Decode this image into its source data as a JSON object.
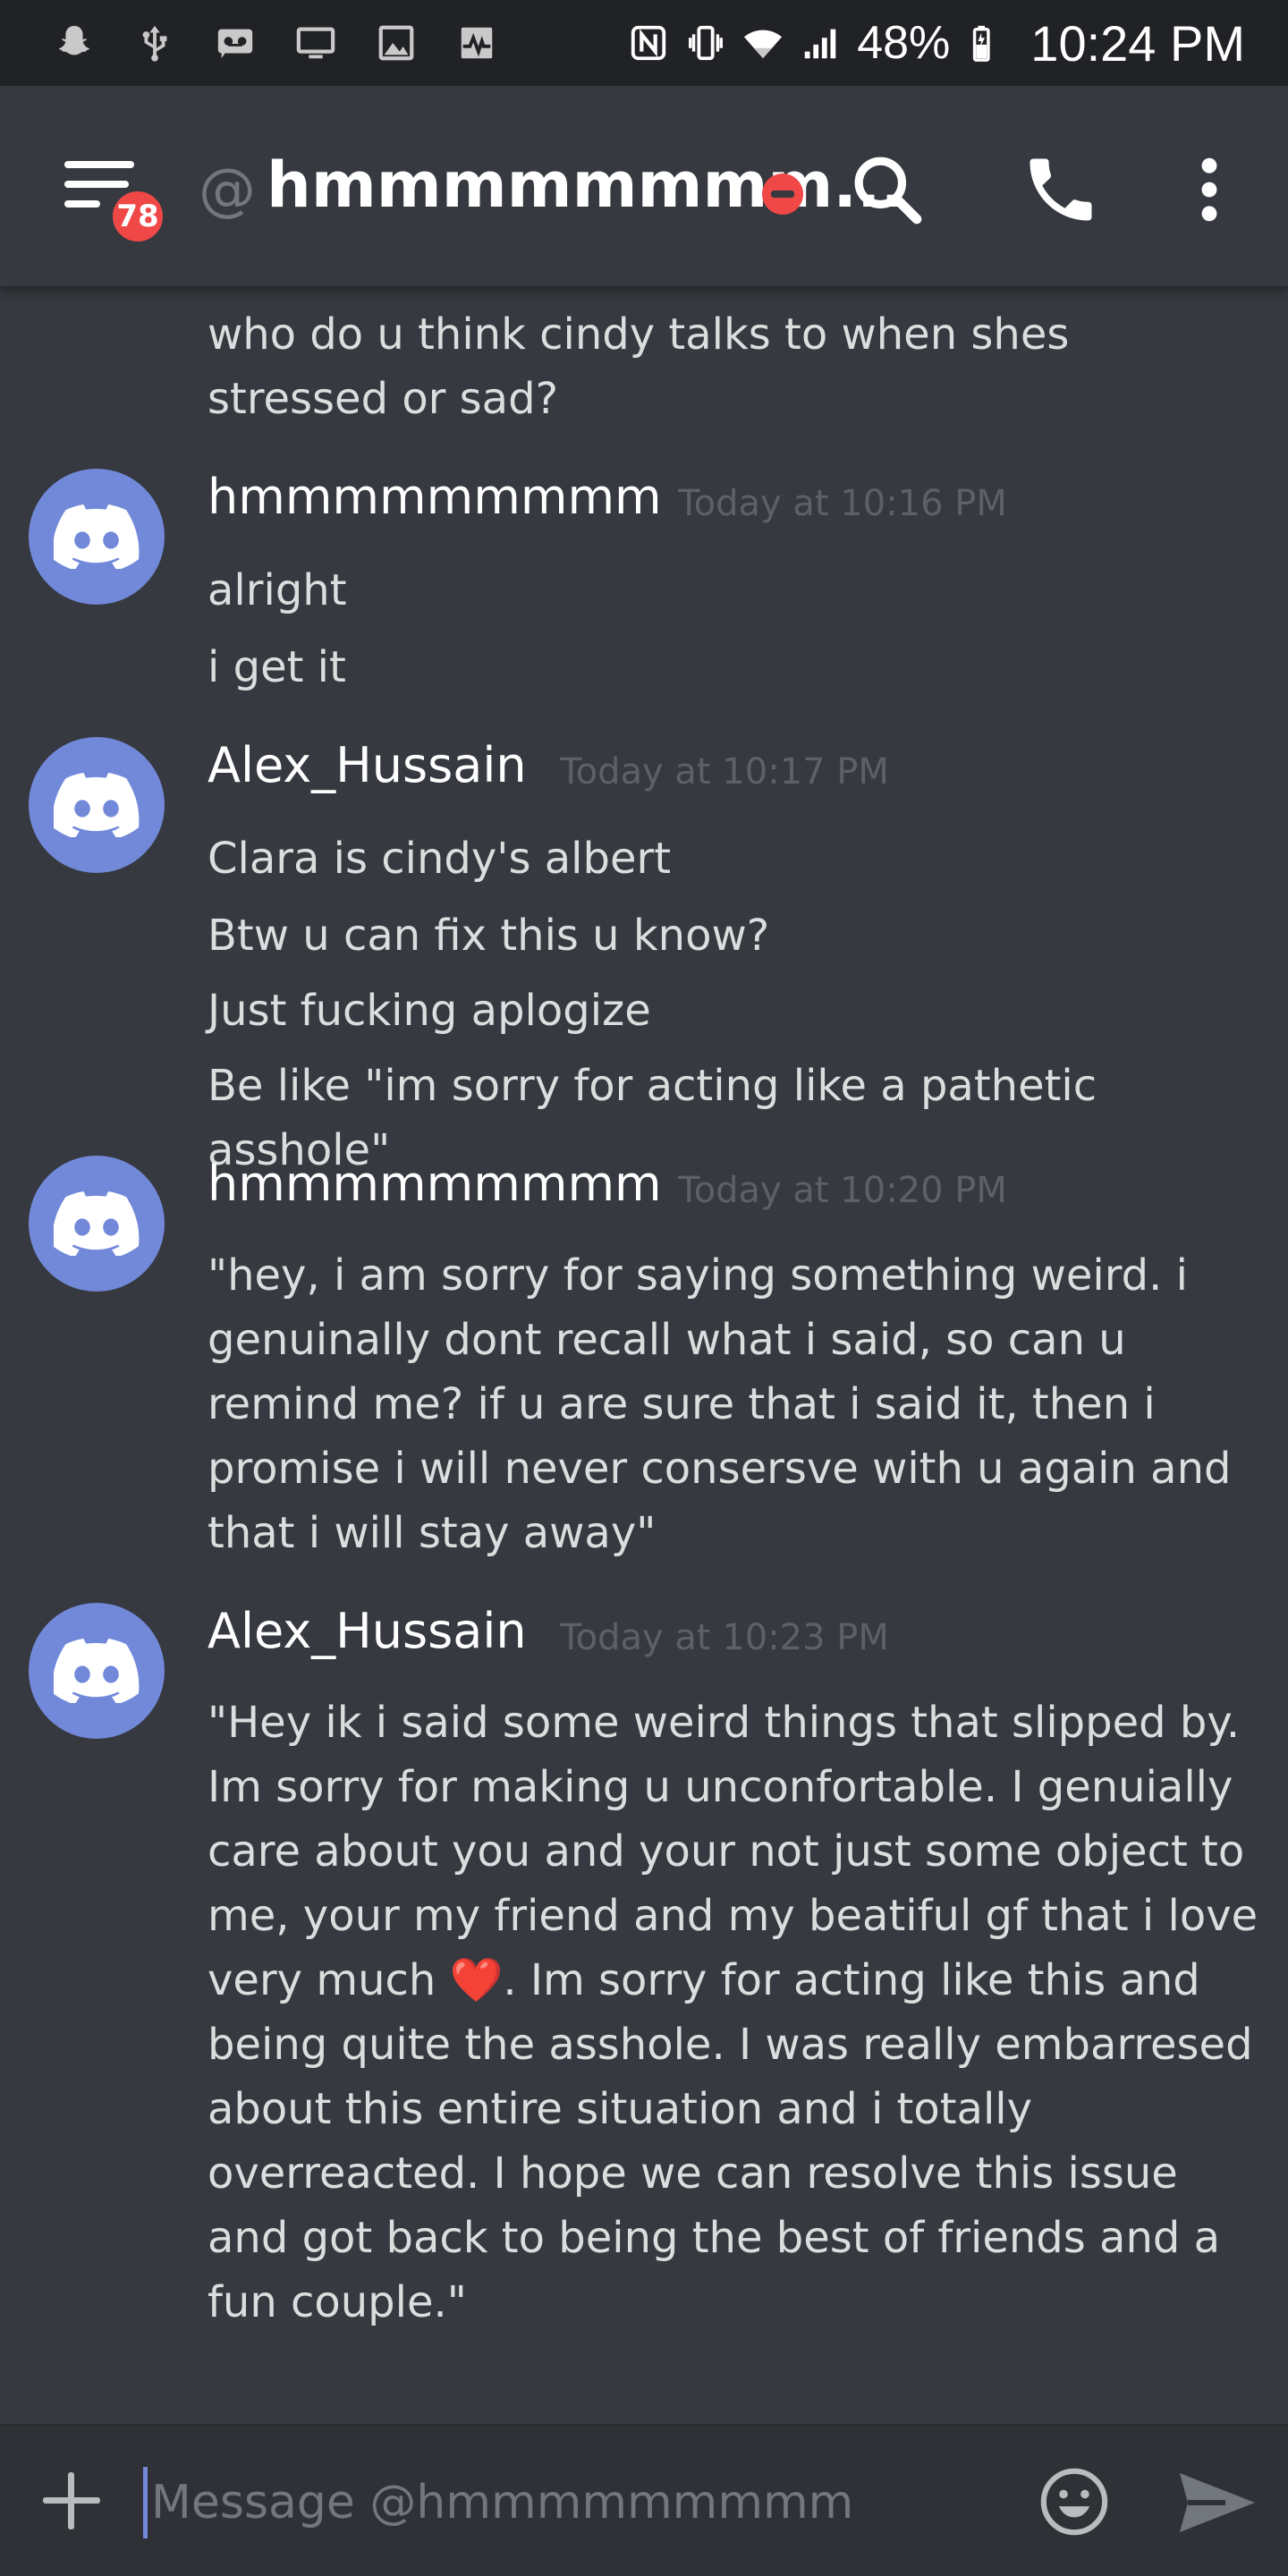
{
  "status_bar": {
    "battery": "48%",
    "time": "10:24 PM",
    "left_icons": [
      "snapchat-icon",
      "usb-icon",
      "voicemail-icon",
      "cast-icon",
      "image-icon",
      "pulse-icon"
    ],
    "right_icons": [
      "nfc-icon",
      "vibrate-icon",
      "wifi-icon",
      "signal-icon",
      "battery-icon"
    ]
  },
  "header": {
    "unread_badge": "78",
    "at_symbol": "@",
    "channel_name": "hmmmmmmmm...",
    "status": "do-not-disturb",
    "icons": [
      "menu-icon",
      "search-icon",
      "phone-icon",
      "more-vert-icon"
    ]
  },
  "messages": {
    "continued_text": "who do u think cindy talks to when shes stressed or sad?",
    "groups": [
      {
        "author": "hmmmmmmmmm",
        "timestamp": "Today at 10:16 PM",
        "lines": [
          "alright",
          "i get it"
        ]
      },
      {
        "author": "Alex_Hussain",
        "timestamp": "Today at 10:17 PM",
        "lines": [
          "Clara is cindy's albert",
          "Btw u can fix this u know?",
          "Just fucking aplogize",
          "Be like \"im sorry for acting like a pathetic asshole\""
        ]
      },
      {
        "author": "hmmmmmmmmm",
        "timestamp": "Today at 10:20 PM",
        "lines": [
          "\"hey, i am sorry for saying something weird. i genuinally dont recall what i said, so can u remind me? if u are sure that i said it, then i promise i will never consersve with u again and that i will stay away\""
        ]
      },
      {
        "author": "Alex_Hussain",
        "timestamp": "Today at 10:23 PM",
        "text_before_heart": "\"Hey ik i said some weird things that slipped by. Im sorry for making u unconfortable. I genuially care about you and your not just some object to me, your my friend and my beatiful gf that i love very much ",
        "heart": "❤️",
        "text_after_heart": ". Im sorry for acting like this and being quite the asshole. I was really embarresed about this entire situation and i totally overreacted. I hope we can resolve this issue and got back to being the best of friends and a fun couple.\""
      }
    ]
  },
  "composer": {
    "placeholder": "Message @hmmmmmmmmm",
    "value": "",
    "icons": [
      "plus-icon",
      "emoji-icon",
      "send-icon"
    ]
  },
  "colors": {
    "background": "#36393f",
    "status_bar": "#202225",
    "blurple": "#7289da",
    "dnd_red": "#f04747",
    "timestamp": "#5d6067"
  }
}
